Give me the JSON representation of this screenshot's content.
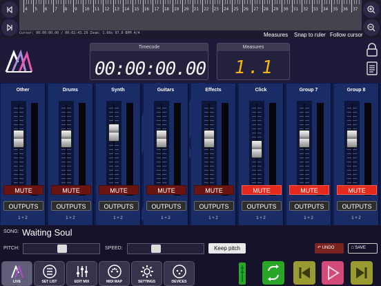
{
  "top": {
    "status_line": "Cursor: 00:00:00.00 / 00:02:43.29 Zoom: 1.00x 97.0 BPM 4/4",
    "ruler_numbers": [
      "4",
      "5",
      "6",
      "7",
      "8",
      "9",
      "10",
      "11",
      "12",
      "13",
      "14",
      "15",
      "16",
      "17",
      "18",
      "19",
      "20",
      "21",
      "22",
      "23",
      "24",
      "25",
      "26",
      "27",
      "28",
      "29",
      "30",
      "31",
      "32",
      "33",
      "34",
      "35",
      "36",
      "37",
      "38",
      "39",
      "40",
      "41",
      "42",
      "43",
      "44"
    ],
    "links": {
      "measures": "Measures",
      "snap": "Snap to ruler",
      "follow": "Follow cursor"
    }
  },
  "header": {
    "timecode_title": "Timecode",
    "timecode_value": "00:00:00.00",
    "measures_title": "Measures",
    "measures_value": "1.1"
  },
  "channels": [
    {
      "name": "Other",
      "mute": "MUTE",
      "muted": false,
      "outputs": "OUTPUTS",
      "route": "1 + 2",
      "fader_level": 0.62
    },
    {
      "name": "Drums",
      "mute": "MUTE",
      "muted": false,
      "outputs": "OUTPUTS",
      "route": "1 + 2",
      "fader_level": 0.62
    },
    {
      "name": "Synth",
      "mute": "MUTE",
      "muted": false,
      "outputs": "OUTPUTS",
      "route": "1 + 2",
      "fader_level": 0.7
    },
    {
      "name": "Guitars",
      "mute": "MUTE",
      "muted": false,
      "outputs": "OUTPUTS",
      "route": "1 + 2",
      "fader_level": 0.62
    },
    {
      "name": "Effects",
      "mute": "MUTE",
      "muted": false,
      "outputs": "OUTPUTS",
      "route": "1 + 2",
      "fader_level": 0.62
    },
    {
      "name": "Click",
      "mute": "MUTE",
      "muted": true,
      "outputs": "OUTPUTS",
      "route": "1 + 2",
      "fader_level": 0.48
    },
    {
      "name": "Group 7",
      "mute": "MUTE",
      "muted": true,
      "outputs": "OUTPUTS",
      "route": "1 + 2",
      "fader_level": 0.62
    },
    {
      "name": "Group 8",
      "mute": "MUTE",
      "muted": true,
      "outputs": "OUTPUTS",
      "route": "1 + 2",
      "fader_level": 0.62
    }
  ],
  "song": {
    "label": "SONG:",
    "name": "Waiting Soul"
  },
  "controls": {
    "pitch_label": "PITCH:",
    "speed_label": "SPEED:",
    "pitch_value": 0.5,
    "speed_value": 0.35,
    "keep_pitch": "Keep pitch",
    "undo": "UNDO",
    "save": "SAVE"
  },
  "nav": [
    {
      "label": "LIVE",
      "icon": "logo-icon",
      "active": true
    },
    {
      "label": "SET LIST",
      "icon": "list-icon",
      "active": false
    },
    {
      "label": "EDIT MIX",
      "icon": "sliders-icon",
      "active": false
    },
    {
      "label": "MIDI MAP",
      "icon": "midi-icon",
      "active": false
    },
    {
      "label": "SETTINGS",
      "icon": "gear-icon",
      "active": false
    },
    {
      "label": "DEVICES",
      "icon": "devices-icon",
      "active": false
    }
  ],
  "colors": {
    "accent": "#e32a1c",
    "measures": "#f6b318",
    "transport_green": "#2aa527",
    "transport_olive": "#9a9a32",
    "transport_play": "#d14a7a"
  }
}
